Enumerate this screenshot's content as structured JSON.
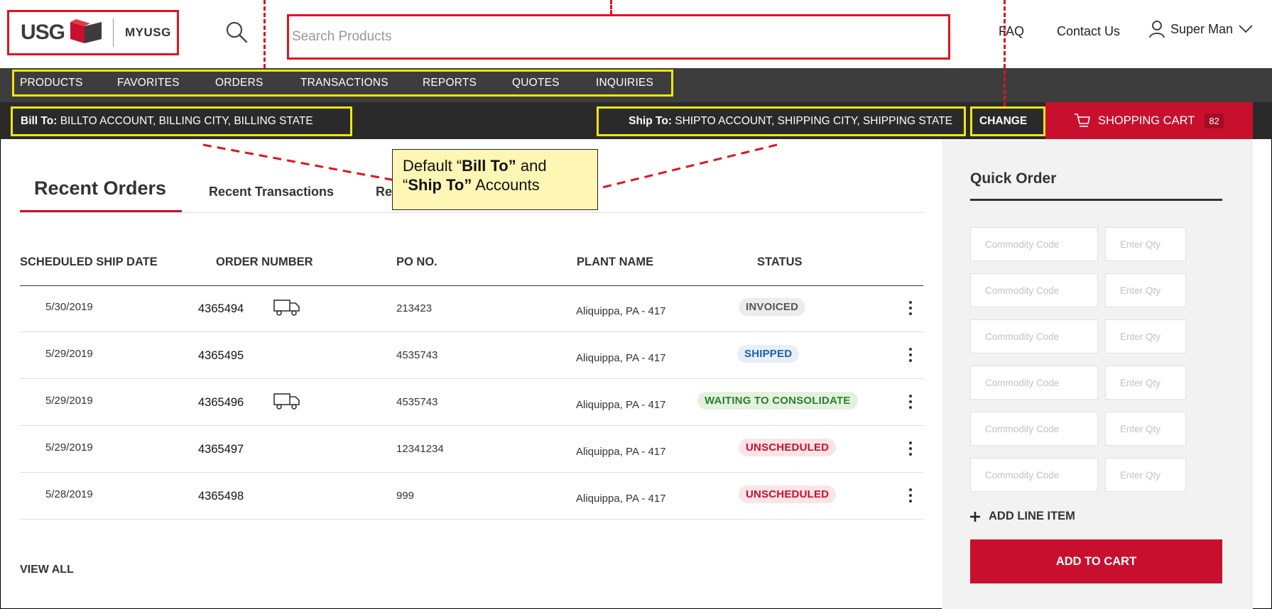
{
  "header": {
    "logo_text": "USG",
    "logo_sub": "MYUSG",
    "search_placeholder": "Search Products",
    "faq": "FAQ",
    "contact": "Contact Us",
    "user_name": "Super Man"
  },
  "nav": {
    "items": [
      {
        "label": "PRODUCTS"
      },
      {
        "label": "FAVORITES"
      },
      {
        "label": "ORDERS"
      },
      {
        "label": "TRANSACTIONS"
      },
      {
        "label": "REPORTS"
      },
      {
        "label": "QUOTES"
      },
      {
        "label": "INQUIRIES"
      }
    ]
  },
  "accounts": {
    "bill_to_label": "Bill To:",
    "bill_to_value": "BILLTO ACCOUNT, BILLING CITY, BILLING STATE",
    "ship_to_label": "Ship To:",
    "ship_to_value": "SHIPTO ACCOUNT, SHIPPING CITY, SHIPPING STATE",
    "change": "CHANGE",
    "cart_label": "SHOPPING CART",
    "cart_count": "82"
  },
  "callout": {
    "line1_pre": "Default “",
    "line1_bold": "Bill To”",
    "line1_post": " and",
    "line2_pre": "“",
    "line2_bold": "Ship To”",
    "line2_post": " Accounts"
  },
  "tabs": {
    "active": "Recent Orders",
    "second": "Recent Transactions",
    "third_partial": "Re"
  },
  "table": {
    "headers": {
      "ship_date": "SCHEDULED SHIP DATE",
      "order_number": "ORDER NUMBER",
      "po": "PO NO.",
      "plant": "PLANT NAME",
      "status": "STATUS"
    },
    "rows": [
      {
        "date": "5/30/2019",
        "order": "4365494",
        "truck": true,
        "po": "213423",
        "plant": "Aliquippa, PA - 417",
        "status": "INVOICED",
        "status_color": "#555555",
        "status_bg": "#ececec"
      },
      {
        "date": "5/29/2019",
        "order": "4365495",
        "truck": false,
        "po": "4535743",
        "plant": "Aliquippa, PA - 417",
        "status": "SHIPPED",
        "status_color": "#1f5fa8",
        "status_bg": "#e7eef7"
      },
      {
        "date": "5/29/2019",
        "order": "4365496",
        "truck": true,
        "po": "4535743",
        "plant": "Aliquippa, PA - 417",
        "status": "WAITING TO CONSOLIDATE",
        "status_color": "#2e7d32",
        "status_bg": "#e3f2dd"
      },
      {
        "date": "5/29/2019",
        "order": "4365497",
        "truck": false,
        "po": "12341234",
        "plant": "Aliquippa, PA - 417",
        "status": "UNSCHEDULED",
        "status_color": "#c8102e",
        "status_bg": "#fbe4e7"
      },
      {
        "date": "5/28/2019",
        "order": "4365498",
        "truck": false,
        "po": "999",
        "plant": "Aliquippa, PA - 417",
        "status": "UNSCHEDULED",
        "status_color": "#c8102e",
        "status_bg": "#fbe4e7"
      }
    ],
    "view_all": "VIEW ALL"
  },
  "quick_order": {
    "title": "Quick Order",
    "commodity_placeholder": "Commodity Code",
    "qty_placeholder": "Enter Qty",
    "add_line": "ADD LINE ITEM",
    "add_to_cart": "ADD TO CART"
  },
  "colors": {
    "brand_red": "#c8102e",
    "annotation_red": "#e0141e",
    "annotation_yellow": "#f0e614",
    "nav_dark": "#3d3d3d",
    "account_bar": "#2a2a2a"
  }
}
